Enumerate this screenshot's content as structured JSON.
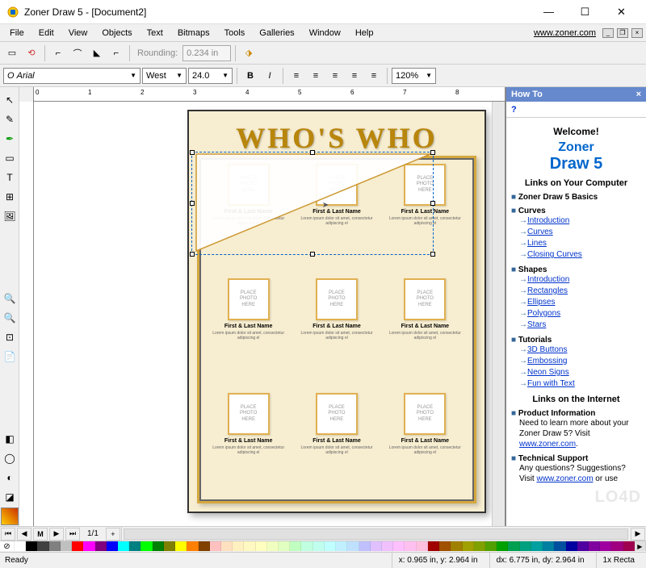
{
  "titlebar": {
    "title": "Zoner Draw 5 - [Document2]"
  },
  "menubar": {
    "items": [
      "File",
      "Edit",
      "View",
      "Objects",
      "Text",
      "Bitmaps",
      "Tools",
      "Galleries",
      "Window",
      "Help"
    ],
    "url": "www.zoner.com"
  },
  "shape_toolbar": {
    "rounding_label": "Rounding:",
    "rounding_value": "0.234 in"
  },
  "text_toolbar": {
    "font": "Arial",
    "lang": "West",
    "size": "24.0",
    "zoom": "120%"
  },
  "ruler": {
    "ticks": [
      "0",
      "1",
      "2",
      "3",
      "4",
      "5",
      "6",
      "7",
      "8"
    ]
  },
  "page": {
    "title": "WHO'S WHO",
    "photo_label": "PLACE\nPHOTO\nHERE",
    "card_name": "First & Last Name",
    "card_desc": "Lorem ipsum dolor sit amet, consectetur adipiscing el"
  },
  "howto": {
    "panel_title": "How To",
    "welcome": "Welcome!",
    "brand1": "Zoner",
    "brand2": "Draw 5",
    "links_computer": "Links on Your Computer",
    "basics": "Zoner Draw 5 Basics",
    "curves": "Curves",
    "curve_links": [
      "Introduction",
      "Curves",
      "Lines",
      "Closing Curves"
    ],
    "shapes": "Shapes",
    "shape_links": [
      "Introduction",
      "Rectangles",
      "Ellipses",
      "Polygons",
      "Stars"
    ],
    "tutorials": "Tutorials",
    "tut_links": [
      "3D Buttons",
      "Embossing",
      "Neon Signs",
      "Fun with Text"
    ],
    "links_internet": "Links on the Internet",
    "product_info": "Product Information",
    "product_text": "Need to learn more about your Zoner Draw 5? Visit",
    "product_url": "www.zoner.com",
    "support": "Technical Support",
    "support_text": "Any questions? Suggestions? Visit",
    "support_url": "www.zoner.com",
    "support_or": " or use"
  },
  "pagenav": {
    "label": "1/1",
    "m": "M"
  },
  "status": {
    "ready": "Ready",
    "pos": "x: 0.965 in, y: 2.964 in",
    "delta": "dx: 6.775 in, dy: 2.964 in",
    "obj": "1x Recta"
  },
  "palette": [
    "#fff",
    "#000",
    "#404040",
    "#808080",
    "#c0c0c0",
    "#ff0000",
    "#ff00ff",
    "#800080",
    "#0000ff",
    "#00ffff",
    "#008080",
    "#00ff00",
    "#008000",
    "#808000",
    "#ffff00",
    "#ff8000",
    "#804000",
    "#ffc0c0",
    "#ffe0c0",
    "#fff0c0",
    "#fff8c0",
    "#ffffc0",
    "#f0ffc0",
    "#e0ffc0",
    "#c0ffc0",
    "#c0ffe0",
    "#c0fff0",
    "#c0ffff",
    "#c0f0ff",
    "#c0e0ff",
    "#c0c0ff",
    "#e0c0ff",
    "#f0c0ff",
    "#ffc0ff",
    "#ffc0f0",
    "#ffc0e0",
    "#a00000",
    "#a05000",
    "#a08000",
    "#a0a000",
    "#80a000",
    "#50a000",
    "#00a000",
    "#00a050",
    "#00a080",
    "#00a0a0",
    "#0080a0",
    "#0050a0",
    "#0000a0",
    "#5000a0",
    "#8000a0",
    "#a000a0",
    "#a00080",
    "#a00050"
  ]
}
